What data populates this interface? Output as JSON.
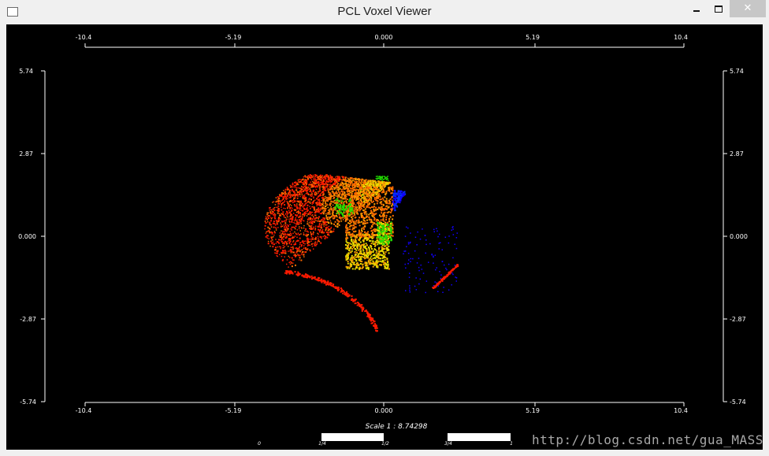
{
  "window": {
    "title": "PCL Voxel Viewer",
    "controls": {
      "minimize": "minimize",
      "maximize": "maximize",
      "close": "✕"
    }
  },
  "axes": {
    "x_ticks": [
      "-10.4",
      "-5.19",
      "0.000",
      "5.19",
      "10.4"
    ],
    "y_ticks": [
      "5.74",
      "2.87",
      "0.000",
      "-2.87",
      "-5.74"
    ]
  },
  "scale": {
    "label": "Scale 1 : 8.74298",
    "ticks": [
      "0",
      "1/4",
      "1/2",
      "3/4",
      "1"
    ]
  },
  "point_cloud": {
    "colors": {
      "red": "#ff1a00",
      "orange": "#ff6a00",
      "amber": "#ffa000",
      "yellow": "#e8e000",
      "green": "#22dd00",
      "blue": "#0033ff",
      "blue_deep": "#1200ff"
    }
  },
  "watermark": "http://blog.csdn.net/gua_MASS"
}
